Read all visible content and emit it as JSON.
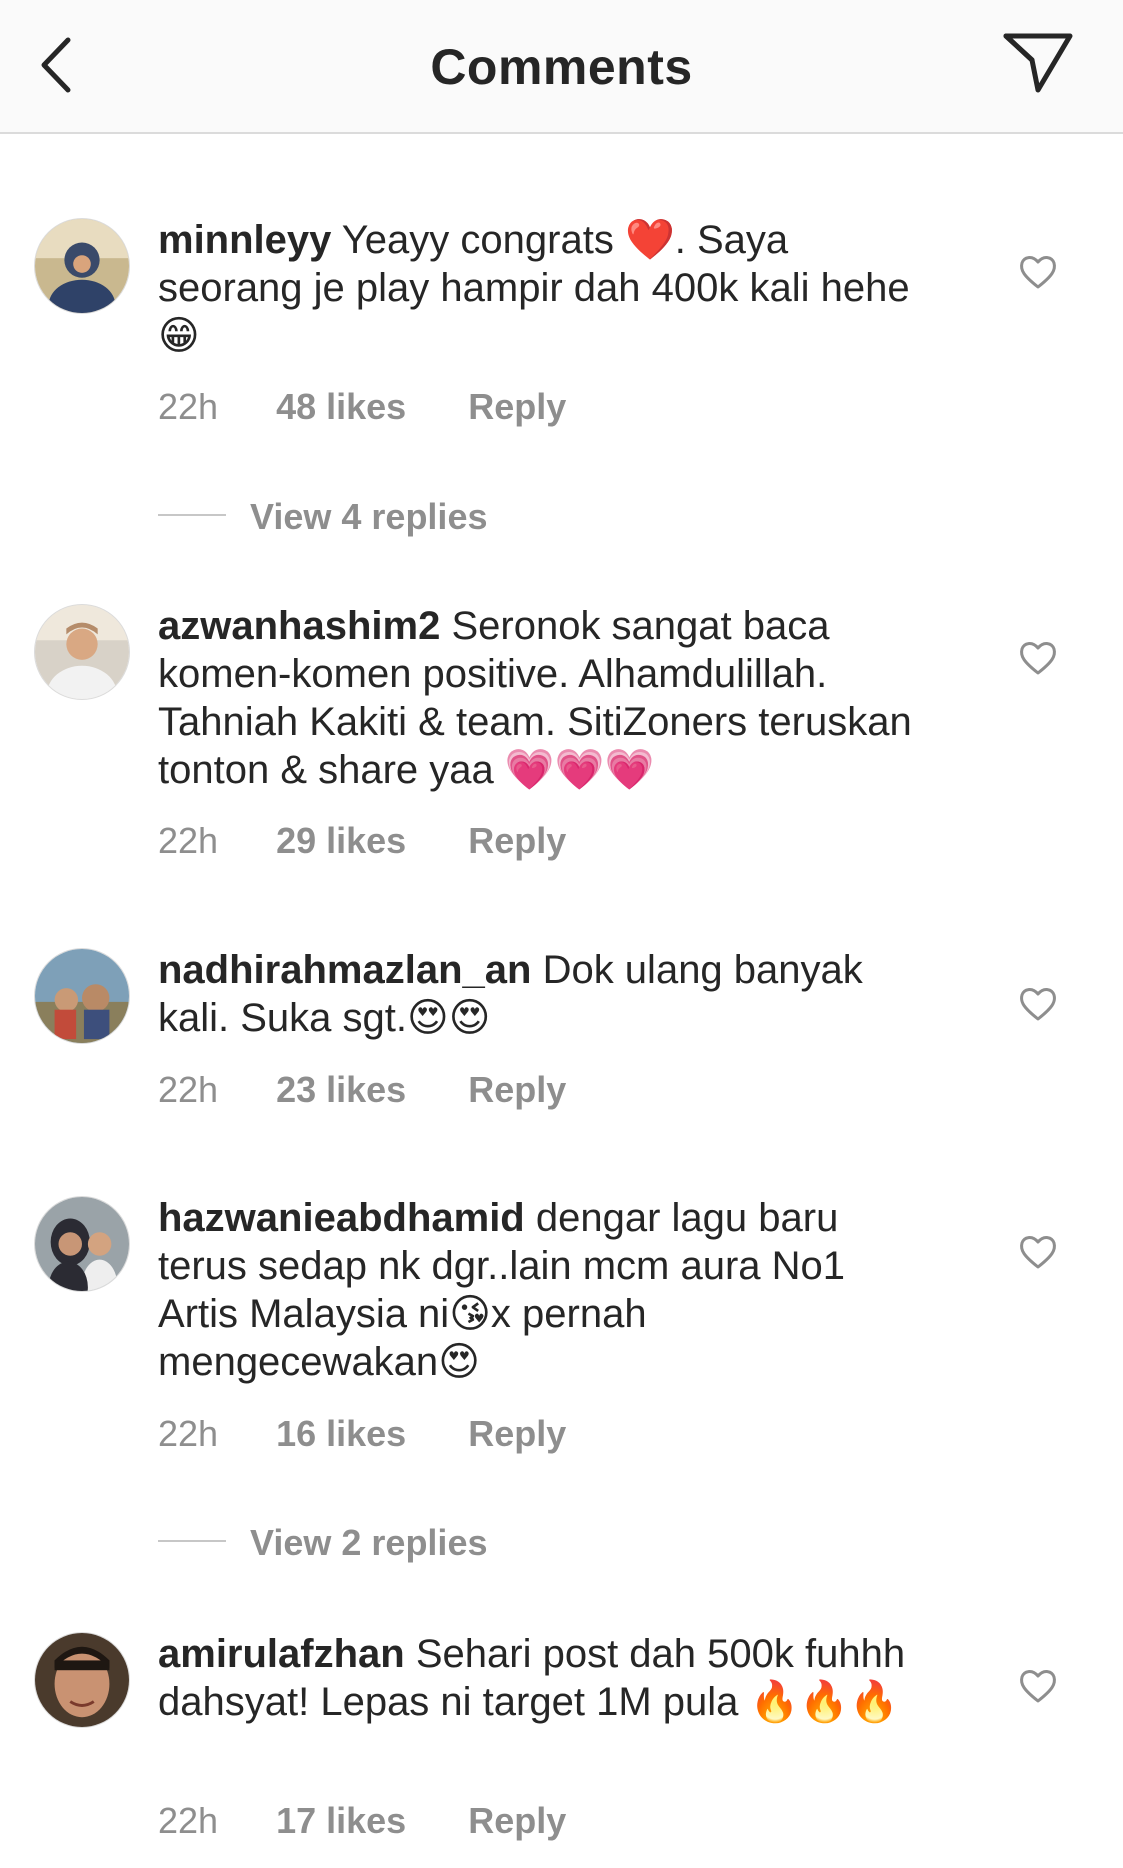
{
  "header": {
    "title": "Comments",
    "back_icon": "chevron-left-icon",
    "send_icon": "paper-plane-icon"
  },
  "comments": [
    {
      "username": "minnleyy",
      "text_parts": [
        "Yeayy congrats ",
        "❤️",
        ". Saya seorang je play hampir dah 400k kali hehe ",
        "😁"
      ],
      "time": "22h",
      "likes": "48 likes",
      "reply": "Reply",
      "view_replies": "View 4 replies"
    },
    {
      "username": "azwanhashim2",
      "text_parts": [
        "Seronok sangat baca komen-komen positive. Alhamdulillah. Tahniah Kakiti & team. SitiZoners teruskan tonton & share yaa ",
        "💗💗💗"
      ],
      "time": "22h",
      "likes": "29 likes",
      "reply": "Reply"
    },
    {
      "username": "nadhirahmazlan_an",
      "text_parts": [
        "Dok ulang banyak kali. Suka sgt.",
        "😍😍"
      ],
      "time": "22h",
      "likes": "23 likes",
      "reply": "Reply"
    },
    {
      "username": "hazwanieabdhamid",
      "text_parts": [
        "dengar lagu baru terus sedap nk dgr..lain mcm aura No1 Artis Malaysia  ni",
        "😘",
        "x pernah mengecewakan",
        "😍"
      ],
      "time": "22h",
      "likes": "16 likes",
      "reply": "Reply",
      "view_replies": "View 2 replies"
    },
    {
      "username": "amirulafzhan",
      "text_parts": [
        "Sehari post dah 500k fuhhh dahsyat! Lepas ni target 1M pula ",
        "🔥🔥🔥"
      ],
      "time": "22h",
      "likes": "17 likes",
      "reply": "Reply"
    }
  ],
  "colors": {
    "text": "#262626",
    "meta": "#8e8e8e",
    "divider": "#dbdbdb",
    "header_bg": "#fafafa"
  }
}
